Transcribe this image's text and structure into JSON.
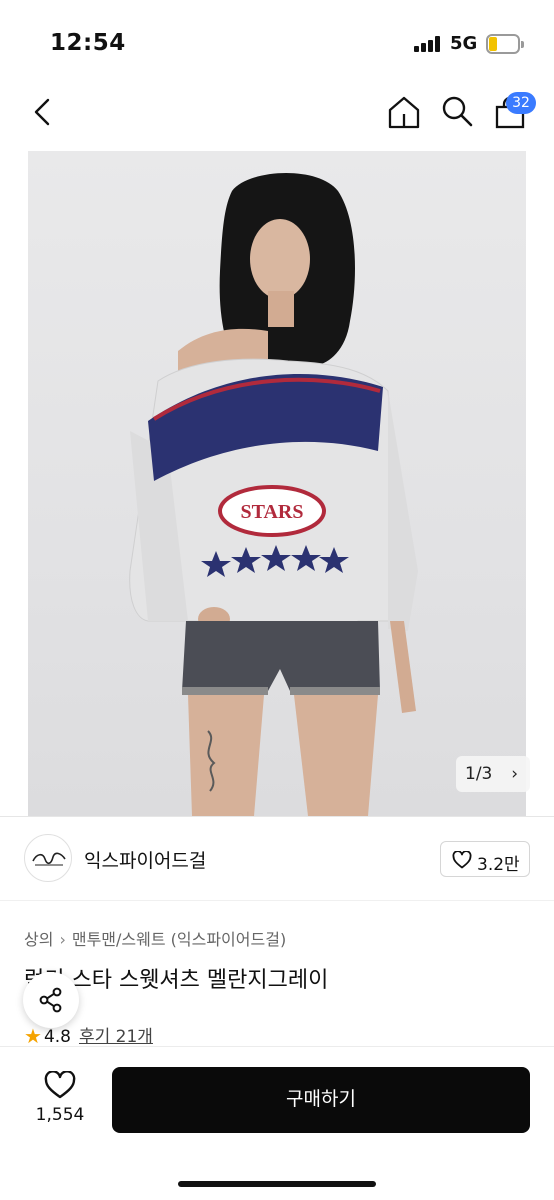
{
  "status_bar": {
    "time": "12:54",
    "network": "5G"
  },
  "nav": {
    "back_icon": "chevron-left-icon",
    "home_icon": "home-icon",
    "search_icon": "search-icon",
    "bag_icon": "shopping-bag-icon",
    "cart_count": "32",
    "badge_color": "#3a7bff"
  },
  "product": {
    "image_counter": "1/3",
    "image_next_icon": "chevron-right-icon",
    "brand_name": "익스파이어드걸",
    "brand_likes": "3.2만",
    "breadcrumb": [
      "상의",
      "맨투맨/스웨트 (익스파이어드걸)"
    ],
    "title": "럭키 스타 스웻셔츠 멜란지그레이",
    "rating": "4.8",
    "reviews": "후기 21개",
    "rating_star_color": "#f5a300"
  },
  "bottom_bar": {
    "wish_count": "1,554",
    "buy_label": "구매하기",
    "buy_button_color": "#0a0a0a"
  }
}
